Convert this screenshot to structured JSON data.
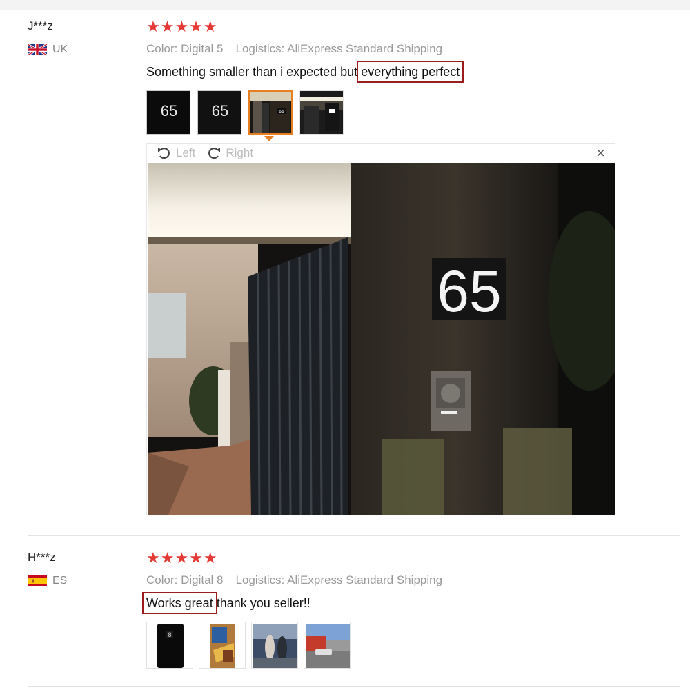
{
  "reviews": [
    {
      "user": "J***z",
      "country": "UK",
      "stars": "★★★★★",
      "color": "Color: Digital 5",
      "logistics": "Logistics: AliExpress Standard Shipping",
      "feedback_pre": "Something smaller than i expected but ",
      "feedback_hl": "everything perfect",
      "feedback_post": "",
      "thumb_labels": [
        "65",
        "65"
      ]
    },
    {
      "user": "H***z",
      "country": "ES",
      "stars": "★★★★★",
      "color": "Color: Digital 8",
      "logistics": "Logistics: AliExpress Standard Shipping",
      "feedback_pre": "",
      "feedback_hl": "Works great",
      "feedback_post": " thank you seller!!",
      "thumb_labels": [
        "8"
      ]
    }
  ],
  "viewer": {
    "left_label": "Left",
    "right_label": "Right",
    "close_label": "×",
    "photo_number": "65"
  },
  "colors": {
    "star": "#e53935",
    "highlight_box": "#9b1c1c",
    "active_thumb": "#e67e22"
  }
}
